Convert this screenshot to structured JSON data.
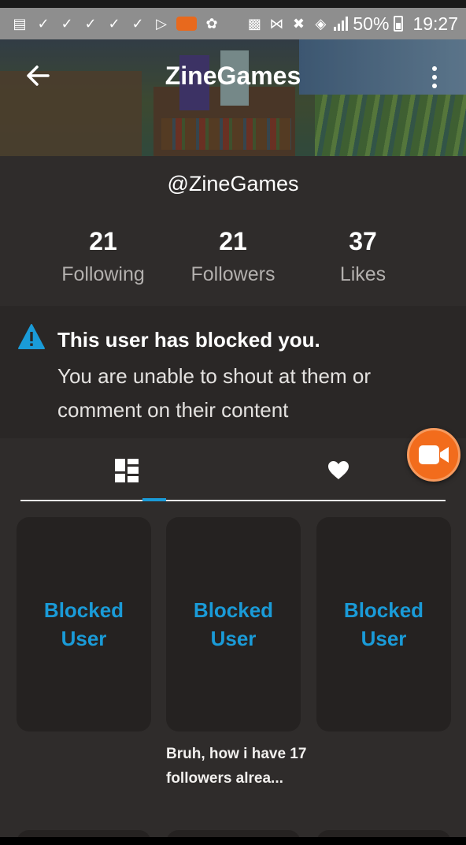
{
  "status_bar": {
    "battery": "50%",
    "time": "19:27"
  },
  "header": {
    "title": "ZineGames",
    "back_icon": "arrow-left-icon",
    "more_icon": "more-vertical-icon"
  },
  "profile": {
    "handle": "@ZineGames",
    "stats": [
      {
        "value": "21",
        "label": "Following"
      },
      {
        "value": "21",
        "label": "Followers"
      },
      {
        "value": "37",
        "label": "Likes"
      }
    ]
  },
  "notice": {
    "title": "This user has blocked you.",
    "body": "You are unable to shout at them or comment on their content",
    "icon": "warning-icon",
    "icon_color": "#1a9bd8"
  },
  "tabs": [
    {
      "icon": "dashboard-grid-icon",
      "active": true
    },
    {
      "icon": "heart-icon",
      "active": false
    }
  ],
  "fab": {
    "icon": "video-camera-icon",
    "color": "#f26c1c"
  },
  "grid": {
    "cards": [
      {
        "line1": "Blocked",
        "line2": "User"
      },
      {
        "line1": "Blocked",
        "line2": "User"
      },
      {
        "line1": "Blocked",
        "line2": "User"
      }
    ],
    "caption": "Bruh, how i have 17 followers alrea..."
  },
  "colors": {
    "accent": "#1a9bd8",
    "background": "#2f2c2b",
    "card": "#252221"
  }
}
